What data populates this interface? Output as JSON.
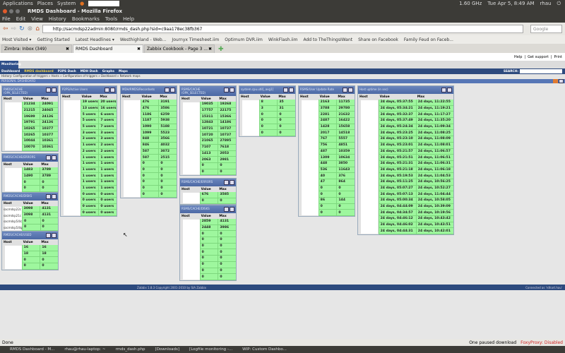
{
  "os_panel": {
    "apps": "Applications",
    "places": "Places",
    "system": "System",
    "cpu": "1.60 GHz",
    "clock": "Tue Apr 5, 8:49 AM",
    "user": "rhau"
  },
  "window": {
    "title": "RMDS Dashboard - Mozilla Firefox"
  },
  "menu": [
    "File",
    "Edit",
    "View",
    "History",
    "Bookmarks",
    "Tools",
    "Help"
  ],
  "url": "http://sacmdsp22admin:8080/rmds_dash.php?sid=c9aa178ec38fb367",
  "search_engine": "Google",
  "bookmarks": [
    "Most Visited ▾",
    "Getting Started",
    "Latest Headlines ▾",
    "Westhighland - Web...",
    "Journyx Timesheet.iim",
    "Optimum DVR.iim",
    "WinkFlash.iim",
    "Add to TheThingsIWant",
    "Share on Facebook",
    "Family Feud on Faceb..."
  ],
  "tabs": [
    {
      "label": "Zimbra: Inbox (349)"
    },
    {
      "label": "RMDS Dashboard"
    },
    {
      "label": "Zabbix Cookbook - Page 3 ..."
    }
  ],
  "zabbix": {
    "top_links": [
      "Help",
      "|",
      "Get support",
      "|",
      "Print"
    ],
    "main_tab": "Monitoring",
    "submenu": [
      "Dashboard",
      "RMDS dashboard",
      "P2PS Dash",
      "MDH Dash",
      "Graphs",
      "Maps"
    ],
    "search_label": "SEARCH:",
    "history": "History: Configuration of triggers » Hosts » Configuration of triggers » Dashboard » Network maps",
    "section_title": "PERSONAL DASHBOARD",
    "columns": [
      "Host",
      "Value",
      "Max"
    ],
    "footer": "Zabbix 1.8.3 Copyright 2001-2010 by SIA Zabbix",
    "connected": "Connected as 'rdhart.hau'"
  },
  "panels": [
    {
      "title": "RMDS/CACHE",
      "subtitle": "(OPK_SELECTED)",
      "rows": [
        [
          "",
          "21234",
          "24091"
        ],
        [
          "",
          "21215",
          "24045"
        ],
        [
          "",
          "19699",
          "24136"
        ],
        [
          "",
          "19791",
          "24136"
        ],
        [
          "",
          "10265",
          "10377"
        ],
        [
          "",
          "10265",
          "10377"
        ],
        [
          "",
          "10044",
          "10361"
        ],
        [
          "",
          "10070",
          "10361"
        ]
      ]
    },
    {
      "title": "RMDS/CACHE/ERRORS",
      "rows": [
        [
          "",
          "1483",
          "3789"
        ],
        [
          "",
          "1490",
          "3789"
        ],
        [
          "",
          "0",
          "0"
        ],
        [
          "",
          "0",
          "0"
        ]
      ]
    },
    {
      "title": "RMDS/CACHE/DISKS",
      "rows": [
        [
          "sacmdsp22c",
          "3098",
          "4131"
        ],
        [
          "sacmdsp21c",
          "3098",
          "4131"
        ],
        [
          "sacmdsp54lc",
          "0",
          "0"
        ],
        [
          "sacmdsp54lg",
          "0",
          "0"
        ]
      ]
    },
    {
      "title": "RMDS/CACHE/USED",
      "rows": [
        [
          "",
          "16",
          "16"
        ],
        [
          "",
          "18",
          "18"
        ],
        [
          "",
          "0",
          "0"
        ],
        [
          "",
          "0",
          "0"
        ]
      ]
    },
    {
      "title": "P2PS/Active Users",
      "rows": [
        [
          "",
          "19 users",
          "20 users"
        ],
        [
          "",
          "13 users",
          "16 users"
        ],
        [
          "",
          "5 users",
          "6 users"
        ],
        [
          "",
          "5 users",
          "7 users"
        ],
        [
          "",
          "5 users",
          "7 users"
        ],
        [
          "",
          "3 users",
          "3 users"
        ],
        [
          "",
          "3 users",
          "3 users"
        ],
        [
          "",
          "1 users",
          "2 users"
        ],
        [
          "",
          "2 users",
          "2 users"
        ],
        [
          "",
          "1 users",
          "1 users"
        ],
        [
          "",
          "1 users",
          "1 users"
        ],
        [
          "",
          "1 users",
          "1 users"
        ],
        [
          "",
          "1 users",
          "1 users"
        ],
        [
          "",
          "1 users",
          "1 users"
        ],
        [
          "",
          "1 users",
          "1 users"
        ],
        [
          "",
          "0 users",
          "0 users"
        ],
        [
          "",
          "0 users",
          "0 users"
        ],
        [
          "",
          "0 users",
          "0 users"
        ],
        [
          "",
          "0 users",
          "0 users"
        ]
      ]
    },
    {
      "title": "MDH/RMDS/Recordsets",
      "rows": [
        [
          "",
          "476",
          "3191"
        ],
        [
          "",
          "476",
          "3586"
        ],
        [
          "",
          "1186",
          "6259"
        ],
        [
          "",
          "1187",
          "5938"
        ],
        [
          "",
          "1090",
          "5188"
        ],
        [
          "",
          "1099",
          "5523"
        ],
        [
          "",
          "848",
          "3566"
        ],
        [
          "",
          "846",
          "4032"
        ],
        [
          "",
          "587",
          "3072"
        ],
        [
          "",
          "587",
          "2515"
        ],
        [
          "",
          "0",
          "0"
        ],
        [
          "",
          "0",
          "0"
        ],
        [
          "",
          "0",
          "0"
        ],
        [
          "",
          "0",
          "0"
        ],
        [
          "",
          "0",
          "0"
        ],
        [
          "",
          "0",
          "0"
        ]
      ]
    },
    {
      "title": "RSMS/CACHE",
      "subtitle": "(OPK_SELECTED)",
      "rows": [
        [
          "",
          "19035",
          "19268"
        ],
        [
          "",
          "17757",
          "22175"
        ],
        [
          "",
          "15311",
          "15366"
        ],
        [
          "",
          "12843",
          "14186"
        ],
        [
          "",
          "10721",
          "10737"
        ],
        [
          "",
          "10720",
          "10737"
        ],
        [
          "",
          "21065",
          "27895"
        ],
        [
          "",
          "7107",
          "7618"
        ],
        [
          "",
          "1413",
          "2053"
        ],
        [
          "",
          "2063",
          "2981"
        ],
        [
          "",
          "0",
          "0"
        ],
        [
          "",
          "0",
          "0"
        ]
      ]
    },
    {
      "title": "RSMS/CACHE/ERRORS",
      "rows": [
        [
          "",
          "676",
          "3585"
        ],
        [
          "",
          "0",
          "0"
        ]
      ]
    },
    {
      "title": "RSMS/CACHE/DISKS",
      "rows": [
        [
          "",
          "2859",
          "4131"
        ],
        [
          "",
          "2448",
          "3986"
        ],
        [
          "",
          "0",
          "0"
        ],
        [
          "",
          "0",
          "0"
        ],
        [
          "",
          "0",
          "0"
        ],
        [
          "",
          "0",
          "0"
        ],
        [
          "",
          "0",
          "0"
        ],
        [
          "",
          "0",
          "0"
        ],
        [
          "",
          "0",
          "0"
        ],
        [
          "",
          "0",
          "0"
        ]
      ]
    },
    {
      "title": "system.cpu.util[,,avg1]",
      "rows": [
        [
          "",
          "8",
          "35"
        ],
        [
          "",
          "3",
          "31"
        ],
        [
          "",
          "0",
          "0"
        ],
        [
          "",
          "0",
          "0"
        ],
        [
          "",
          "0",
          "0"
        ],
        [
          "",
          "0",
          "0"
        ]
      ]
    },
    {
      "title": "RSMS/User Update Rate",
      "rows": [
        [
          "",
          "2163",
          "11735"
        ],
        [
          "",
          "3788",
          "29780"
        ],
        [
          "",
          "2281",
          "21632"
        ],
        [
          "",
          "2487",
          "16422"
        ],
        [
          "",
          "1428",
          "15658"
        ],
        [
          "",
          "2017",
          "14518"
        ],
        [
          "",
          "767",
          "5557"
        ],
        [
          "",
          "756",
          "4851"
        ],
        [
          "",
          "487",
          "10359"
        ],
        [
          "",
          "1309",
          "10634"
        ],
        [
          "",
          "448",
          "3850"
        ],
        [
          "",
          "536",
          "11643"
        ],
        [
          "",
          "40",
          "376"
        ],
        [
          "",
          "47",
          "864"
        ],
        [
          "",
          "0",
          "0"
        ],
        [
          "",
          "0",
          "0"
        ],
        [
          "",
          "86",
          "144"
        ],
        [
          "",
          "0",
          "0"
        ],
        [
          "",
          "0",
          "0"
        ]
      ]
    },
    {
      "title": "Host uptime (in sec)",
      "rows": [
        [
          "",
          "24 days, 05:37:55",
          "24 days, 11:22:55"
        ],
        [
          "",
          "24 days, 05:34:21",
          "24 days, 11:19:21"
        ],
        [
          "",
          "24 days, 05:32:37",
          "24 days, 11:17:27"
        ],
        [
          "",
          "24 days, 05:37:49",
          "24 days, 11:35:20"
        ],
        [
          "",
          "24 days, 05:24:34",
          "24 days, 11:09:34"
        ],
        [
          "",
          "24 days, 05:23:25",
          "24 days, 11:08:25"
        ],
        [
          "",
          "24 days, 05:23:10",
          "24 days, 11:08:09"
        ],
        [
          "",
          "24 days, 05:23:01",
          "24 days, 11:08:01"
        ],
        [
          "",
          "24 days, 05:21:57",
          "24 days, 11:06:57"
        ],
        [
          "",
          "24 days, 05:21:51",
          "24 days, 11:06:51"
        ],
        [
          "",
          "24 days, 05:21:31",
          "24 days, 11:06:31"
        ],
        [
          "",
          "24 days, 05:21:18",
          "24 days, 11:06:18"
        ],
        [
          "",
          "24 days, 05:19:53",
          "24 days, 11:04:53"
        ],
        [
          "",
          "24 days, 05:11:25",
          "24 days, 10:56:25"
        ],
        [
          "",
          "24 days, 05:07:27",
          "24 days, 10:52:27"
        ],
        [
          "",
          "24 days, 05:07:13",
          "24 days, 11:04:44"
        ],
        [
          "",
          "24 days, 05:00:34",
          "24 days, 10:58:05"
        ],
        [
          "",
          "24 days, 04:44:09",
          "24 days, 10:39:09"
        ],
        [
          "",
          "24 days, 04:34:57",
          "24 days, 10:19:56"
        ],
        [
          "",
          "24 days, 04:46:12",
          "24 days, 10:43:42"
        ],
        [
          "",
          "24 days, 04:46:02",
          "24 days, 10:43:51"
        ],
        [
          "",
          "24 days, 04:44:31",
          "24 days, 10:42:01"
        ]
      ]
    }
  ],
  "statusbar": {
    "left": "Done",
    "download": "One paused download",
    "foxyproxy": "FoxyProxy: Disabled"
  },
  "taskbar": [
    "RMDS Dashboard - M...",
    "rhau@rhau-laptop: ~",
    "rmds_dash.php",
    "[Downloads]",
    "[Logfile monitoring -...",
    "WIP: Custom Dashbo..."
  ],
  "colors": {
    "zabbix_blue": "#2d4a7e",
    "cell_green": "#9ef79e",
    "foxyproxy": "#d02020"
  }
}
